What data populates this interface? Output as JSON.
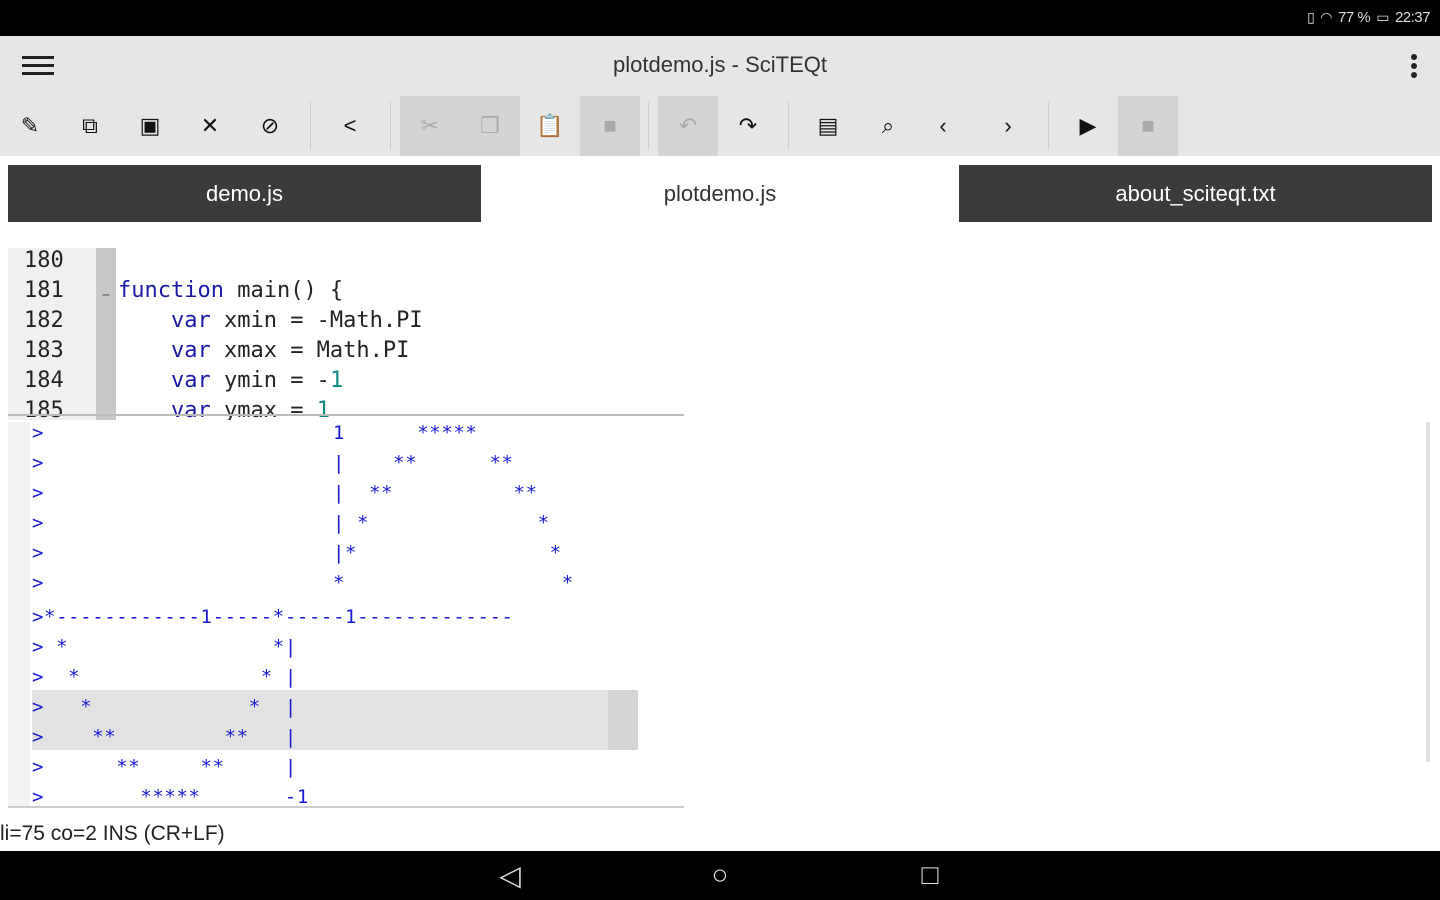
{
  "status_bar": {
    "battery": "77 %",
    "time": "22:37"
  },
  "app": {
    "title": "plotdemo.js - SciTEQt"
  },
  "toolbar": {
    "buttons": [
      {
        "name": "edit",
        "icon": "pencil-icon",
        "glyph": "✎",
        "disabled": false
      },
      {
        "name": "open",
        "icon": "open-external-icon",
        "glyph": "⧉",
        "disabled": false
      },
      {
        "name": "save",
        "icon": "save-icon",
        "glyph": "▣",
        "disabled": false
      },
      {
        "name": "close",
        "icon": "close-icon",
        "glyph": "✕",
        "disabled": false
      },
      {
        "name": "hide",
        "icon": "eye-off-icon",
        "glyph": "⊘",
        "disabled": false
      },
      {
        "name": "share",
        "icon": "share-icon",
        "glyph": "<",
        "disabled": false
      },
      {
        "name": "cut",
        "icon": "cut-icon",
        "glyph": "✂",
        "disabled": true
      },
      {
        "name": "copy",
        "icon": "copy-icon",
        "glyph": "❐",
        "disabled": true
      },
      {
        "name": "paste",
        "icon": "paste-icon",
        "glyph": "📋",
        "disabled": false
      },
      {
        "name": "delete",
        "icon": "delete-icon",
        "glyph": "■",
        "disabled": true
      },
      {
        "name": "undo",
        "icon": "undo-icon",
        "glyph": "↶",
        "disabled": true
      },
      {
        "name": "redo",
        "icon": "redo-icon",
        "glyph": "↷",
        "disabled": false
      },
      {
        "name": "find",
        "icon": "find-in-page-icon",
        "glyph": "▤",
        "disabled": false
      },
      {
        "name": "search",
        "icon": "search-icon",
        "glyph": "⌕",
        "disabled": false
      },
      {
        "name": "prev",
        "icon": "chevron-left-icon",
        "glyph": "‹",
        "disabled": false
      },
      {
        "name": "next",
        "icon": "chevron-right-icon",
        "glyph": "›",
        "disabled": false
      },
      {
        "name": "run",
        "icon": "play-icon",
        "glyph": "▶",
        "disabled": false
      },
      {
        "name": "stop",
        "icon": "stop-icon",
        "glyph": "■",
        "disabled": true
      }
    ]
  },
  "tabs": [
    {
      "label": "demo.js",
      "active": false
    },
    {
      "label": "plotdemo.js",
      "active": true
    },
    {
      "label": "about_sciteqt.txt",
      "active": false
    }
  ],
  "editor": {
    "line_numbers": [
      "180",
      "181",
      "182",
      "183",
      "184",
      "185"
    ],
    "lines": [
      {
        "kw": "",
        "rest": "",
        "num": ""
      },
      {
        "kw": "function",
        "rest": " main() {",
        "num": ""
      },
      {
        "kw": "    var",
        "rest": " xmin = -Math.PI",
        "num": ""
      },
      {
        "kw": "    var",
        "rest": " xmax = Math.PI",
        "num": ""
      },
      {
        "kw": "    var",
        "rest": " ymin = -",
        "num": "1"
      },
      {
        "kw": "    var",
        "rest": " ymax = ",
        "num": "1"
      }
    ]
  },
  "console": {
    "lines": [
      ">                        1      *****",
      ">                        |    **      **",
      ">                        |  **          **",
      ">                        | *              *",
      ">                        |*                *",
      ">                        *                  *",
      ">*------------1-----*-----1-------------",
      "> *                 *|",
      ">  *               * |",
      ">   *             *  |",
      ">    **         **   |",
      ">      **     **     |",
      ">        *****       -1"
    ]
  },
  "status_line": "li=75 co=2 INS (CR+LF)"
}
